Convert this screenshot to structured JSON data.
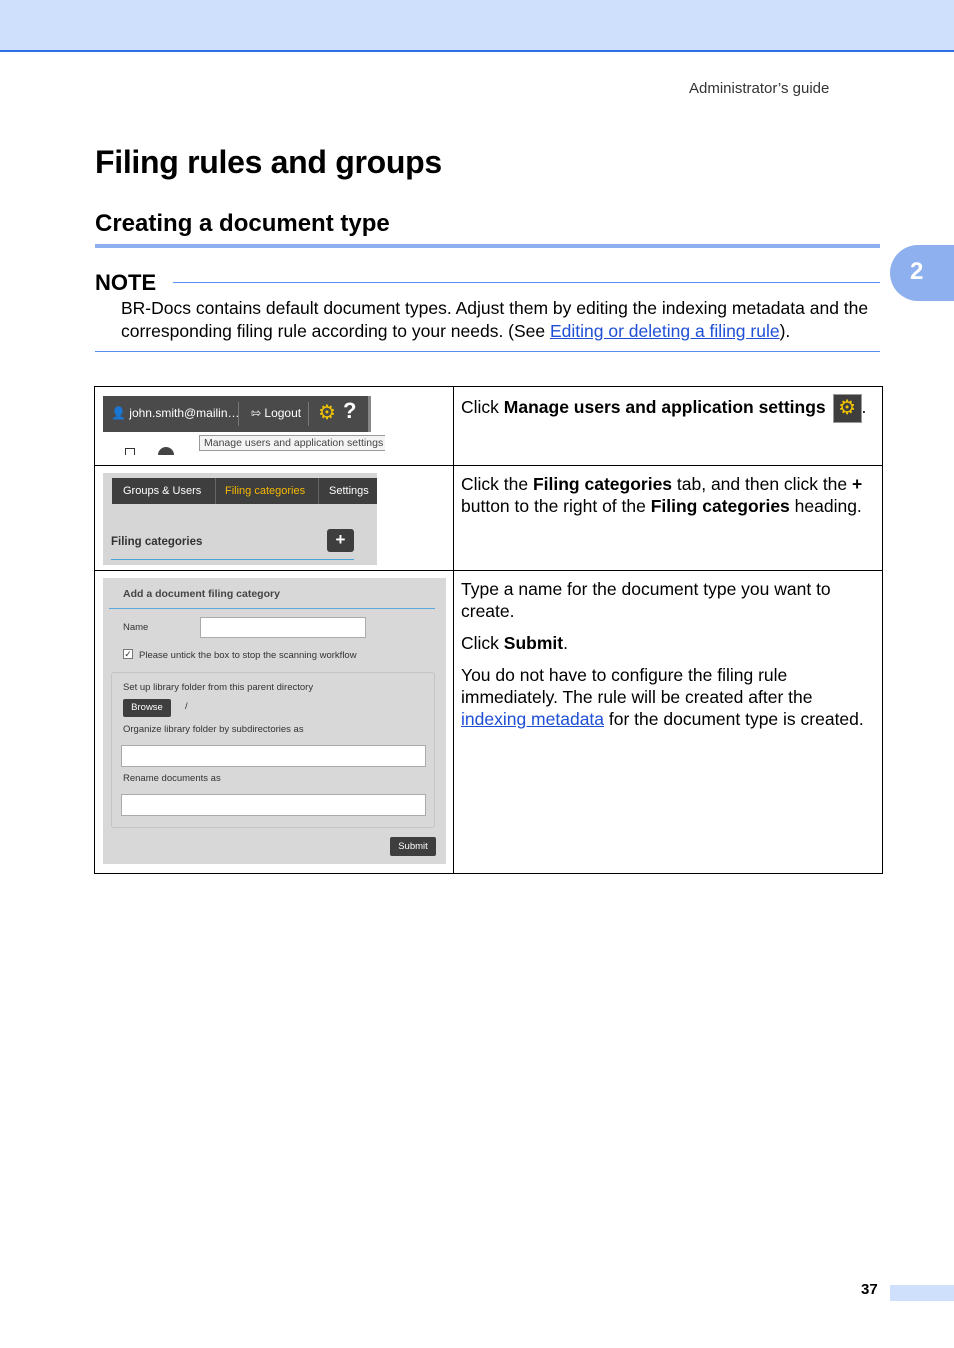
{
  "header": {
    "running_head": "Administrator’s guide"
  },
  "chapter": {
    "title": "Filing rules and groups",
    "tab_number": "2"
  },
  "section": {
    "title": "Creating a document type"
  },
  "note": {
    "title": "NOTE",
    "text_before_link": "BR-Docs contains default document types. Adjust them by editing the indexing metadata and the corresponding filing rule according to your needs. (See ",
    "link": "Editing or deleting a filing rule",
    "text_after_link": ")."
  },
  "step1": {
    "prefix": "Click ",
    "bold": "Manage users and application settings",
    "suffix": ".",
    "shot": {
      "user": "john.smith@mailin…",
      "logout": "Logout",
      "tooltip": "Manage users and application settings"
    }
  },
  "step2": {
    "p1": "Click the ",
    "b1": "Filing categories",
    "p2": " tab, and then click the ",
    "b2": "+",
    "p3": " button to the right of the ",
    "b3": "Filing categories",
    "p4": " heading.",
    "shot": {
      "tab_groups": "Groups & Users",
      "tab_filing": "Filing categories",
      "tab_settings": "Settings",
      "heading": "Filing categories",
      "plus": "+"
    }
  },
  "step3": {
    "para1": "Type a name for the document type you want to create.",
    "para2_prefix": "Click ",
    "para2_bold": "Submit",
    "para2_suffix": ".",
    "para3_before": "You do not have to configure the filing rule immediately. The rule will be created after the ",
    "para3_link": "indexing metadata",
    "para3_after": " for the document type is created.",
    "shot": {
      "title": "Add a document filing category",
      "name_label": "Name",
      "checkbox_label": "Please untick the box to stop the scanning workflow",
      "parent_dir_label": "Set up library folder from this parent directory",
      "browse": "Browse",
      "path": "/",
      "subdir_label": "Organize library folder by subdirectories as",
      "rename_label": "Rename documents as",
      "submit": "Submit"
    }
  },
  "footer": {
    "page_number": "37"
  }
}
